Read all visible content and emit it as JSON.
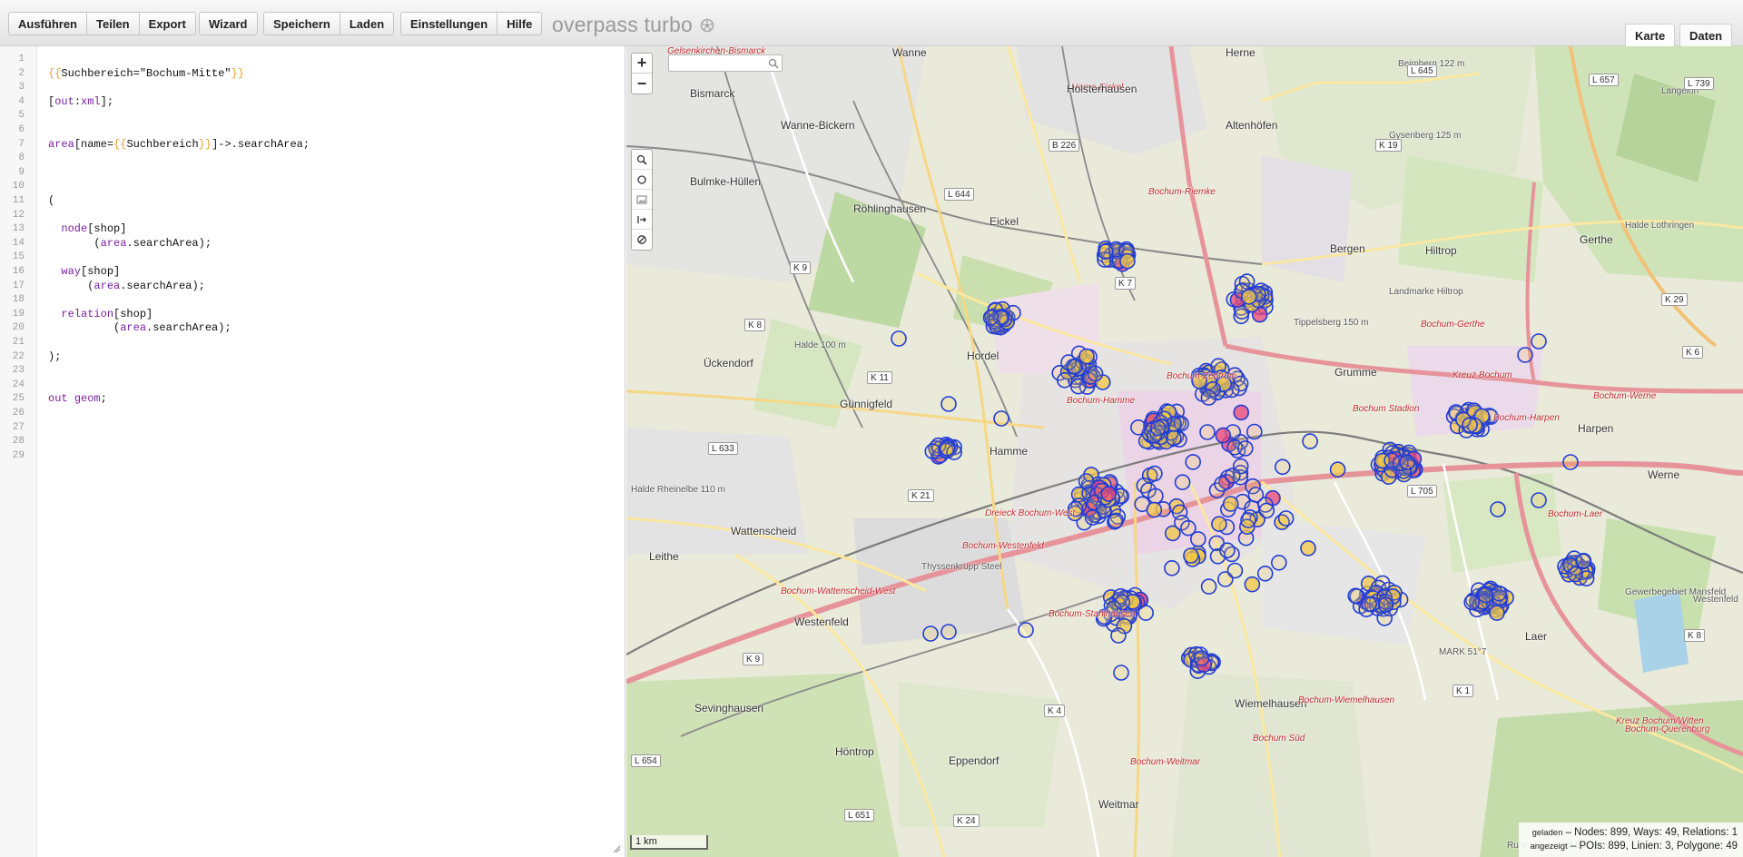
{
  "toolbar": {
    "buttons_group1": [
      "Ausführen",
      "Teilen",
      "Export"
    ],
    "buttons_group2": [
      "Wizard"
    ],
    "buttons_group3": [
      "Speichern",
      "Laden"
    ],
    "buttons_group4": [
      "Einstellungen",
      "Hilfe"
    ],
    "app_title": "overpass turbo",
    "logo_icon": "gear-icon"
  },
  "view_tabs": {
    "map": "Karte",
    "data": "Daten"
  },
  "editor": {
    "line_numbers": [
      "1",
      "2",
      "3",
      "4",
      "5",
      "6",
      "7",
      "8",
      "9",
      "10",
      "11",
      "12",
      "13",
      "14",
      "15",
      "16",
      "17",
      "18",
      "19",
      "20",
      "21",
      "22",
      "23",
      "24",
      "25",
      "26",
      "27",
      "28",
      "29"
    ],
    "lines": [
      "",
      "{{Suchbereich=\"Bochum-Mitte\"}}",
      "",
      "[out:xml];",
      "",
      "",
      "area[name={{Suchbereich}}]->.searchArea;",
      "",
      "",
      "",
      "(",
      "",
      "  node[shop]",
      "       (area.searchArea);",
      "",
      "  way[shop]",
      "      (area.searchArea);",
      "",
      "  relation[shop]",
      "          (area.searchArea);",
      "",
      ");",
      "",
      "",
      "out geom;",
      "",
      "",
      "",
      ""
    ]
  },
  "map": {
    "zoom_in": "+",
    "zoom_out": "−",
    "search_placeholder": "",
    "scale": "1 km",
    "places": [
      {
        "name": "Gelsenkirchen-Bismarck",
        "cls": "red"
      },
      {
        "name": "Wanne",
        "cls": ""
      },
      {
        "name": "Herne",
        "cls": ""
      },
      {
        "name": "Herne-Eickel",
        "cls": "red"
      },
      {
        "name": "Bismarck",
        "cls": ""
      },
      {
        "name": "Holsterhausen",
        "cls": ""
      },
      {
        "name": "Wanne-Bickern",
        "cls": ""
      },
      {
        "name": "Altenhöfen",
        "cls": ""
      },
      {
        "name": "Bulmke-Hüllen",
        "cls": ""
      },
      {
        "name": "Röhlinghausen",
        "cls": ""
      },
      {
        "name": "Eickel",
        "cls": ""
      },
      {
        "name": "Bergen",
        "cls": ""
      },
      {
        "name": "Hiltrop",
        "cls": ""
      },
      {
        "name": "Gerthe",
        "cls": ""
      },
      {
        "name": "Hordel",
        "cls": ""
      },
      {
        "name": "Ückendorf",
        "cls": ""
      },
      {
        "name": "Günnigfeld",
        "cls": ""
      },
      {
        "name": "Hamme",
        "cls": ""
      },
      {
        "name": "Grumme",
        "cls": ""
      },
      {
        "name": "Harpen",
        "cls": ""
      },
      {
        "name": "Werne",
        "cls": ""
      },
      {
        "name": "Wattenscheid",
        "cls": ""
      },
      {
        "name": "Leithe",
        "cls": ""
      },
      {
        "name": "Westenfeld",
        "cls": ""
      },
      {
        "name": "Laer",
        "cls": ""
      },
      {
        "name": "Sevinghausen",
        "cls": ""
      },
      {
        "name": "Wiemelhausen",
        "cls": ""
      },
      {
        "name": "Höntrop",
        "cls": ""
      },
      {
        "name": "Eppendorf",
        "cls": ""
      },
      {
        "name": "Weitmar",
        "cls": ""
      },
      {
        "name": "Bochum-Riemke",
        "cls": "red"
      },
      {
        "name": "Bochum-Hamme",
        "cls": "red"
      },
      {
        "name": "Bochum-Zentrum",
        "cls": "red"
      },
      {
        "name": "Bochum Stadion",
        "cls": "red"
      },
      {
        "name": "Bochum-Harpen",
        "cls": "red"
      },
      {
        "name": "Bochum-Gerthe",
        "cls": "red"
      },
      {
        "name": "Kreuz Bochum",
        "cls": "red"
      },
      {
        "name": "Bochum-Werne",
        "cls": "red"
      },
      {
        "name": "Dreieck Bochum-West",
        "cls": "red"
      },
      {
        "name": "Bochum-Westenfeld",
        "cls": "red"
      },
      {
        "name": "Bochum-Wattenscheid-West",
        "cls": "red"
      },
      {
        "name": "Bochum-Stahlhausen",
        "cls": "red"
      },
      {
        "name": "Bochum-Laer",
        "cls": "red"
      },
      {
        "name": "Bochum-Wiemelhausen",
        "cls": "red"
      },
      {
        "name": "Bochum-Weitmar",
        "cls": "red"
      },
      {
        "name": "Bochum Süd",
        "cls": "red"
      },
      {
        "name": "Kreuz Bochum/Witten",
        "cls": "red"
      },
      {
        "name": "Bochum-Querenburg",
        "cls": "red"
      },
      {
        "name": "Tippelsberg 150 m",
        "cls": "small"
      },
      {
        "name": "Halde 100 m",
        "cls": "small"
      },
      {
        "name": "Halde Rheinelbe 110 m",
        "cls": "small"
      },
      {
        "name": "Thyssenkrupp Steel",
        "cls": "small"
      },
      {
        "name": "MARK 51°7",
        "cls": "small"
      },
      {
        "name": "Gewerbegebiet Mansfeld",
        "cls": "small"
      },
      {
        "name": "Landmarke Hiltrop",
        "cls": "small"
      },
      {
        "name": "Beimberg 122 m",
        "cls": "small"
      },
      {
        "name": "Langeloh",
        "cls": "small"
      },
      {
        "name": "Gysenberg 125 m",
        "cls": "small"
      },
      {
        "name": "Halde Lothringen",
        "cls": "small"
      },
      {
        "name": "Ruhr-Universität Bochum",
        "cls": "small"
      },
      {
        "name": "Westenfeld",
        "cls": "small"
      }
    ],
    "roads": [
      "L 645",
      "L 657",
      "L 739",
      "K 19",
      "B 226",
      "L 644",
      "K 7",
      "K 9",
      "K 8",
      "K 11",
      "L 633",
      "K 21",
      "K 29",
      "K 6",
      "L 705",
      "K 8",
      "K 9",
      "K 1",
      "K 4",
      "L 654",
      "L 651",
      "K 24"
    ],
    "tools": [
      "search-icon",
      "circle-icon",
      "image-icon",
      "export-icon",
      "forbidden-icon"
    ]
  },
  "stats": {
    "loaded_label": "geladen",
    "loaded_text": " – Nodes: 899, Ways: 49, Relations: 1",
    "shown_label": "angezeigt",
    "shown_text": " – POIs: 899, Linien: 3, Polygone: 49"
  },
  "colors": {
    "accent_blue": "#1f3cd8",
    "poi_fill": "#f3c747",
    "poi_fill_dense": "#e8477a",
    "road_main": "#e2898d",
    "road_secondary": "#f7d786",
    "forest": "#b8d6a1",
    "residential": "#e0dfdf"
  }
}
